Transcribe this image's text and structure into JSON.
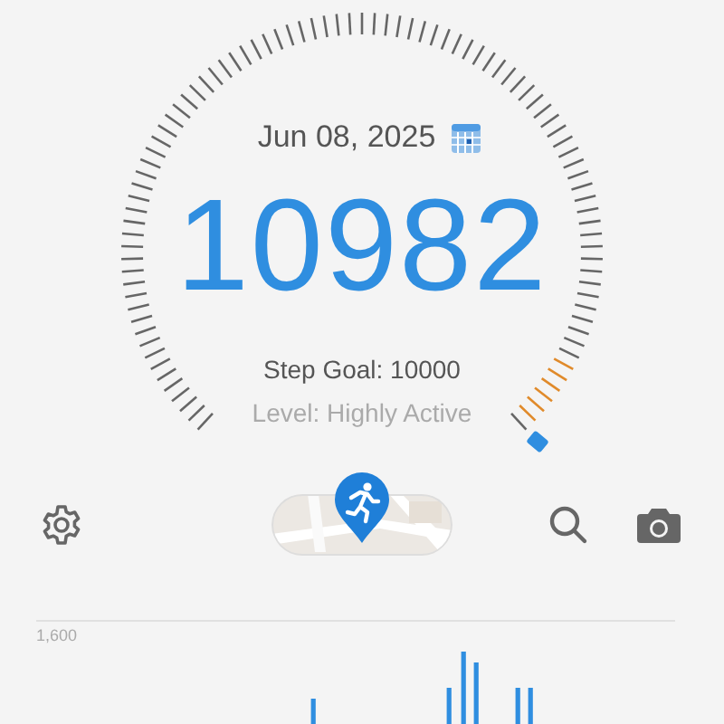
{
  "date": "Jun 08, 2025",
  "steps": "10982",
  "step_goal": "Step Goal: 10000",
  "level_label": "Level: Highly Active",
  "chart": {
    "y_label": "1,600"
  }
}
